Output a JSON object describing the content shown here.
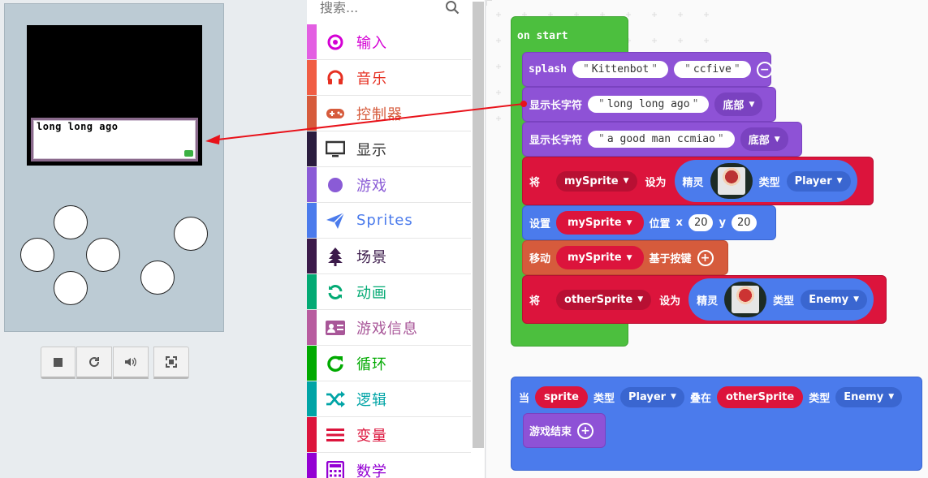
{
  "simulator": {
    "dialog_text": "long long ago",
    "toolbar": {
      "stop_icon": "stop-icon",
      "restart_icon": "restart-icon",
      "sound_icon": "volume-icon",
      "fullscreen_icon": "fullscreen-icon"
    }
  },
  "search": {
    "placeholder": "搜索..."
  },
  "toolbox": {
    "items": [
      {
        "label": "输入",
        "color": "#d400d4",
        "stripe": "#e35fe2",
        "icon": "input-target-icon"
      },
      {
        "label": "音乐",
        "color": "#e63022",
        "stripe": "#f05d44",
        "icon": "headphones-icon"
      },
      {
        "label": "控制器",
        "color": "#d65b3c",
        "stripe": "#d65b3c",
        "icon": "gamepad-icon"
      },
      {
        "label": "显示",
        "color": "#333333",
        "stripe": "#2a1c3e",
        "icon": "monitor-icon"
      },
      {
        "label": "游戏",
        "color": "#8a5bd6",
        "stripe": "#8a5bd6",
        "icon": "circle-icon"
      },
      {
        "label": "Sprites",
        "color": "#4b7bec",
        "stripe": "#4b7bec",
        "icon": "paper-plane-icon"
      },
      {
        "label": "场景",
        "color": "#3b1a4a",
        "stripe": "#3b1a4a",
        "icon": "tree-icon"
      },
      {
        "label": "动画",
        "color": "#03aa74",
        "stripe": "#03aa74",
        "icon": "refresh-icon"
      },
      {
        "label": "游戏信息",
        "color": "#a85698",
        "stripe": "#b85c9f",
        "icon": "id-card-icon"
      },
      {
        "label": "循环",
        "color": "#00aa00",
        "stripe": "#00aa00",
        "icon": "loop-icon"
      },
      {
        "label": "逻辑",
        "color": "#00a4a6",
        "stripe": "#00a4a6",
        "icon": "shuffle-icon"
      },
      {
        "label": "变量",
        "color": "#dc143c",
        "stripe": "#dc143c",
        "icon": "variable-icon"
      },
      {
        "label": "数学",
        "color": "#9400d3",
        "stripe": "#9400d3",
        "icon": "calculator-icon"
      }
    ]
  },
  "workspace": {
    "on_start": {
      "hat_label": "on start",
      "splash": {
        "label": "splash",
        "arg1": "Kittenbot",
        "arg2": "ccfive"
      },
      "show_long_text_1": {
        "label": "显示长字符",
        "text": "long long ago",
        "position": "底部"
      },
      "show_long_text_2": {
        "label": "显示长字符",
        "text": "a good man ccmiao",
        "position": "底部"
      },
      "set_sprite_1": {
        "label_set": "将",
        "var": "mySprite",
        "label_to": "设为",
        "label_sprite": "精灵",
        "label_kind": "类型",
        "kind": "Player"
      },
      "set_position": {
        "label": "设置",
        "var": "mySprite",
        "label_pos": "位置",
        "label_x": "x",
        "x": "20",
        "label_y": "y",
        "y": "20"
      },
      "move": {
        "label": "移动",
        "var": "mySprite",
        "label_buttons": "基于按键"
      },
      "set_sprite_2": {
        "label_set": "将",
        "var": "otherSprite",
        "label_to": "设为",
        "label_sprite": "精灵",
        "label_kind": "类型",
        "kind": "Enemy"
      }
    },
    "overlap": {
      "label_when": "当",
      "var1": "sprite",
      "label_kind1": "类型",
      "kind1": "Player",
      "label_overlaps": "叠在",
      "var2": "otherSprite",
      "label_kind2": "类型",
      "kind2": "Enemy",
      "game_over": "游戏结束"
    }
  },
  "colors": {
    "event_green": "#4cbf3e",
    "text_purple": "#8e52d6",
    "variables_red": "#dc143c",
    "sprites_blue": "#4b7bec",
    "controller_orange": "#d65b3c"
  }
}
